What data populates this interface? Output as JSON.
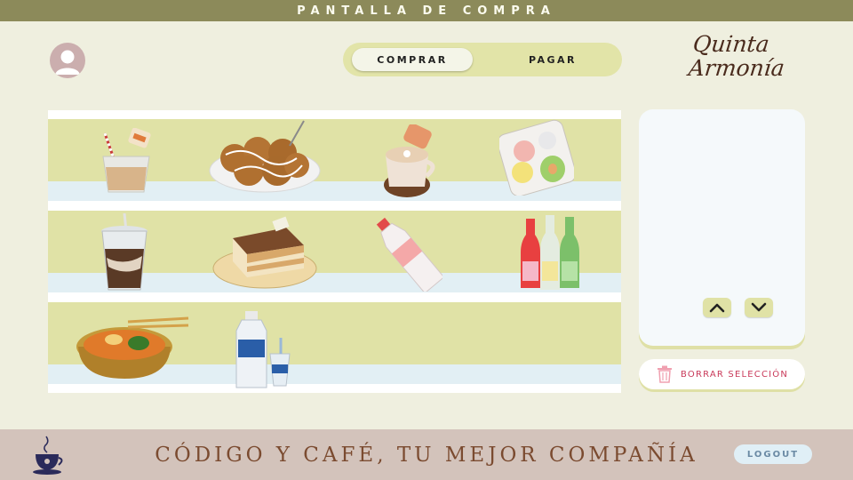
{
  "header": {
    "title": "PANTALLA DE COMPRA"
  },
  "user": {
    "avatar_icon": "user-avatar-icon"
  },
  "tabs": [
    {
      "label": "COMPRAR",
      "active": true
    },
    {
      "label": "PAGAR",
      "active": false
    }
  ],
  "brand": {
    "line1": "Quinta",
    "line2": "Armonía"
  },
  "products": [
    {
      "icon": "iced-latte-icon"
    },
    {
      "icon": "takoyaki-icon"
    },
    {
      "icon": "coffee-cup-icon"
    },
    {
      "icon": "bento-box-icon"
    },
    {
      "icon": "iced-coffee-cup-icon"
    },
    {
      "icon": "tiramisu-icon"
    },
    {
      "icon": "drink-bottle-icon"
    },
    {
      "icon": "ramune-bottles-icon"
    },
    {
      "icon": "ramen-pot-icon"
    },
    {
      "icon": "water-bottle-icon"
    }
  ],
  "cart": {
    "scroll_up_icon": "chevron-up-icon",
    "scroll_down_icon": "chevron-down-icon"
  },
  "clear_button": {
    "label": "BORRAR SELECCIÓN",
    "icon": "trash-icon"
  },
  "footer": {
    "slogan": "CÓDIGO Y CAFÉ, TU MEJOR COMPAÑÍA",
    "logo_icon": "coffee-logo-icon"
  },
  "logout": {
    "label": "LOGOUT"
  },
  "colors": {
    "topbar": "#8c8a5a",
    "background": "#efefdf",
    "shelf_band": "#e0e2a6",
    "shelf_strip": "#e2eff4",
    "footer": "#d3c3bb",
    "brand": "#4a2b1d",
    "accent_red": "#c93a5a"
  }
}
